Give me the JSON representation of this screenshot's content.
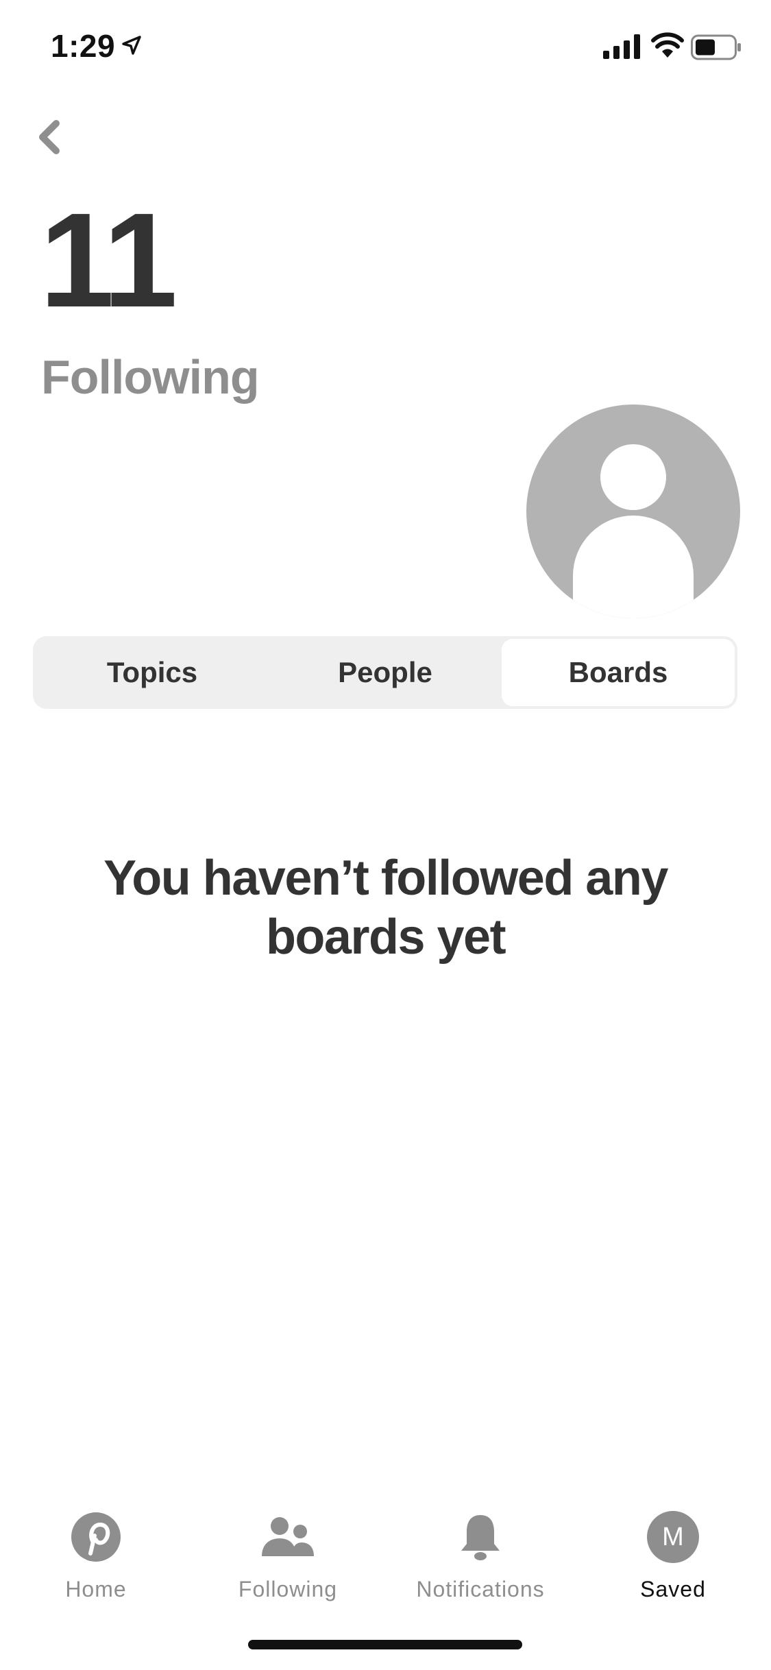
{
  "status_bar": {
    "time": "1:29",
    "location_icon": "location-arrow-icon",
    "signal_icon": "cellular-signal-icon",
    "wifi_icon": "wifi-icon",
    "battery_icon": "battery-icon"
  },
  "header": {
    "back_icon": "chevron-left-icon",
    "count": "11",
    "count_label": "Following"
  },
  "avatar_icon": "default-avatar-icon",
  "tabs": [
    {
      "label": "Topics",
      "active": false
    },
    {
      "label": "People",
      "active": false
    },
    {
      "label": "Boards",
      "active": true
    }
  ],
  "empty_state": {
    "line1": "You haven’t followed any",
    "line2": "boards yet"
  },
  "bottom_nav": {
    "items": [
      {
        "label": "Home",
        "icon": "pinterest-icon",
        "active": false
      },
      {
        "label": "Following",
        "icon": "people-icon",
        "active": false
      },
      {
        "label": "Notifications",
        "icon": "bell-icon",
        "active": false
      },
      {
        "label": "Saved",
        "icon": "profile-avatar-icon",
        "avatar_initial": "M",
        "active": true
      }
    ]
  },
  "colors": {
    "text_dark": "#333333",
    "text_muted": "#8e8e8e",
    "tab_bg": "#efefef",
    "avatar_bg": "#b3b3b3"
  }
}
